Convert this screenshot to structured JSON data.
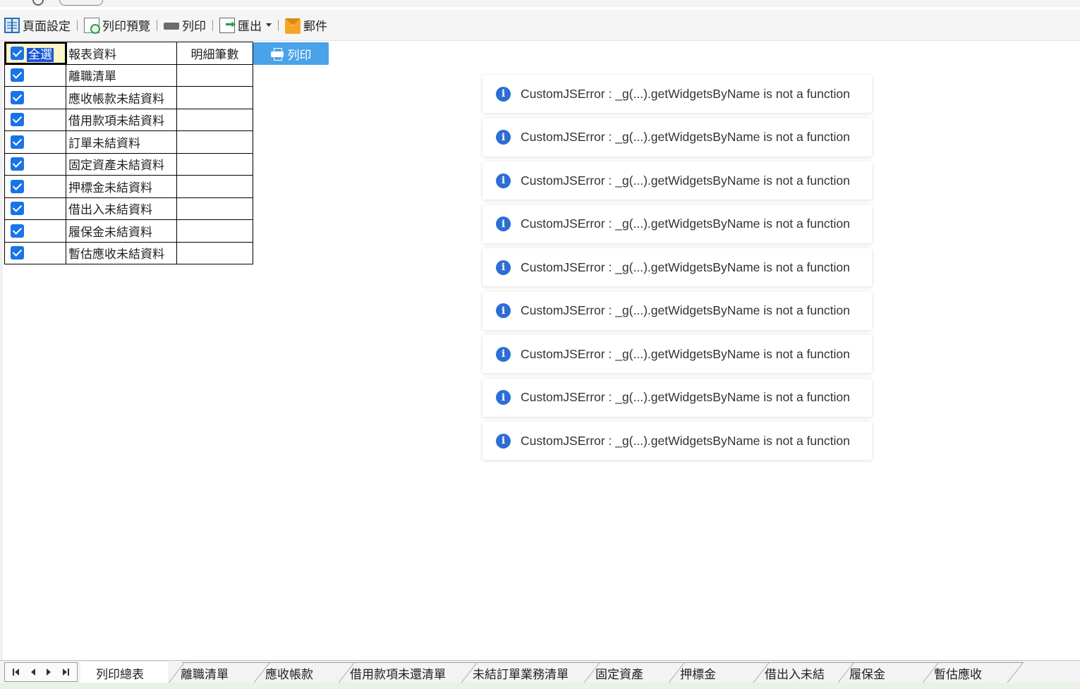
{
  "toolbar": {
    "page_setup": "頁面設定",
    "print_preview": "列印預覽",
    "print": "列印",
    "export": "匯出",
    "mail": "郵件"
  },
  "table": {
    "select_all": "全選",
    "col_report": "報表資料",
    "col_count": "明細筆數",
    "rows": [
      "離職清單",
      "應收帳款未結資料",
      "借用款項未結資料",
      "訂單未結資料",
      "固定資產未結資料",
      "押標金未結資料",
      "借出入未結資料",
      "履保金未結資料",
      "暫估應收未結資料"
    ]
  },
  "print_button": "列印",
  "toasts": [
    "CustomJSError : _g(...).getWidgetsByName is not a function",
    "CustomJSError : _g(...).getWidgetsByName is not a function",
    "CustomJSError : _g(...).getWidgetsByName is not a function",
    "CustomJSError : _g(...).getWidgetsByName is not a function",
    "CustomJSError : _g(...).getWidgetsByName is not a function",
    "CustomJSError : _g(...).getWidgetsByName is not a function",
    "CustomJSError : _g(...).getWidgetsByName is not a function",
    "CustomJSError : _g(...).getWidgetsByName is not a function",
    "CustomJSError : _g(...).getWidgetsByName is not a function"
  ],
  "tabs": [
    "列印總表",
    "離職清單",
    "應收帳款",
    "借用款項未還清單",
    "未結訂單業務清單",
    "固定資產",
    "押標金",
    "借出入未結",
    "履保金",
    "暫估應收"
  ],
  "colors": {
    "accent": "#1a73e8",
    "print_button": "#4aa3e8",
    "info_icon": "#2c6ed5"
  },
  "icons": {
    "page_setup": "page-setup-icon",
    "print_preview": "print-preview-icon",
    "print": "printer-icon",
    "export": "export-icon",
    "mail": "mail-icon",
    "toast": "info-icon"
  }
}
